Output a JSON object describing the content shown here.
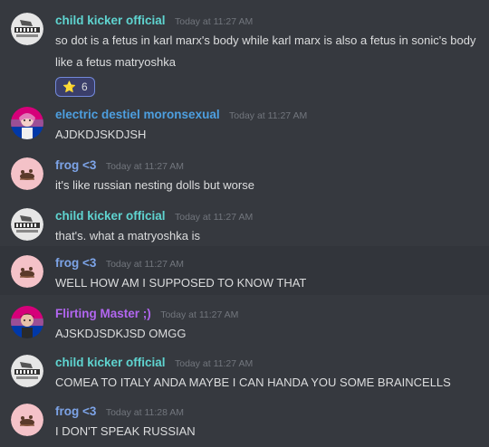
{
  "messages": [
    {
      "author": "child kicker official",
      "author_color": "#5fd4d0",
      "timestamp": "Today at 11:27 AM",
      "lines": [
        "so dot is a fetus in karl marx's body while karl marx is also a fetus in sonic's body",
        "like a fetus matryoshka"
      ],
      "reaction": {
        "emoji": "⭐",
        "count": "6"
      },
      "avatar": "piano-avatar"
    },
    {
      "author": "electric destiel moronsexual",
      "author_color": "#4d9fe0",
      "timestamp": "Today at 11:27 AM",
      "lines": [
        "AJDKDJSKDJSH"
      ],
      "avatar": "bi-flag-character-avatar"
    },
    {
      "author": "frog <3",
      "author_color": "#8ea6ea",
      "timestamp": "Today at 11:27 AM",
      "lines": [
        "it's like russian nesting dolls but worse"
      ],
      "avatar": "pink-frog-avatar"
    },
    {
      "author": "child kicker official",
      "author_color": "#5fd4d0",
      "timestamp": "Today at 11:27 AM",
      "lines": [
        "that's. what a matryoshka is"
      ],
      "avatar": "piano-avatar"
    },
    {
      "author": "frog <3",
      "author_color": "#8ea6ea",
      "timestamp": "Today at 11:27 AM",
      "lines": [
        "WELL HOW AM I SUPPOSED TO KNOW THAT"
      ],
      "avatar": "pink-frog-avatar"
    },
    {
      "author": "Flirting Master ;)",
      "author_color": "#b266f0",
      "timestamp": "Today at 11:27 AM",
      "lines": [
        "AJSKDJSDKJSD OMGG"
      ],
      "avatar": "bi-flag-character-avatar"
    },
    {
      "author": "child kicker official",
      "author_color": "#5fd4d0",
      "timestamp": "Today at 11:27 AM",
      "lines": [
        "COMEA TO ITALY ANDA MAYBE I CAN HANDA YOU SOME BRAINCELLS"
      ],
      "avatar": "piano-avatar"
    },
    {
      "author": "frog <3",
      "author_color": "#8ea6ea",
      "timestamp": "Today at 11:28 AM",
      "lines": [
        "I DON'T SPEAK RUSSIAN"
      ],
      "avatar": "pink-frog-avatar"
    }
  ]
}
